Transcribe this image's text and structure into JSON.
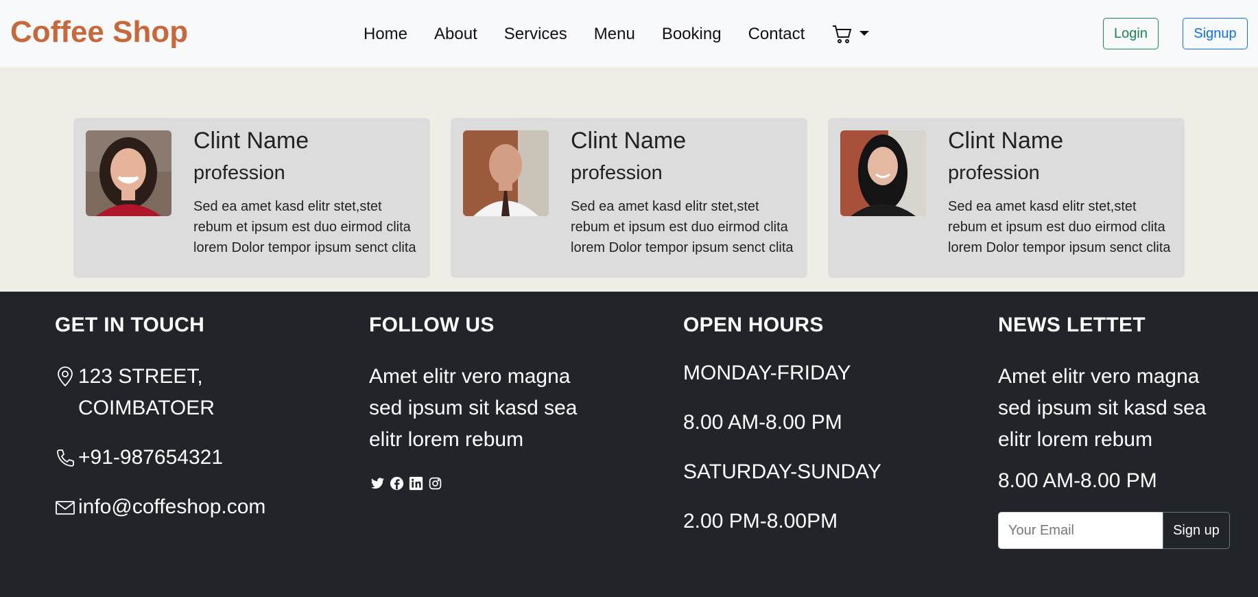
{
  "navbar": {
    "brand": "Coffee Shop",
    "links": [
      "Home",
      "About",
      "Services",
      "Menu",
      "Booking",
      "Contact"
    ],
    "cart_icon": "cart-icon",
    "login_label": "Login",
    "signup_label": "Signup"
  },
  "testimonials": [
    {
      "name": "Clint Name",
      "profession": "profession",
      "text": "Sed ea amet kasd elitr stet,stet rebum et ipsum est duo eirmod clita lorem Dolor tempor ipsum senct clita",
      "avatar": "woman-red-top"
    },
    {
      "name": "Clint Name",
      "profession": "profession",
      "text": "Sed ea amet kasd elitr stet,stet rebum et ipsum est duo eirmod clita lorem Dolor tempor ipsum senct clita",
      "avatar": "man-tie"
    },
    {
      "name": "Clint Name",
      "profession": "profession",
      "text": "Sed ea amet kasd elitr stet,stet rebum et ipsum est duo eirmod clita lorem Dolor tempor ipsum senct clita",
      "avatar": "woman-dark-hair"
    }
  ],
  "footer": {
    "contact": {
      "title": "GET IN TOUCH",
      "address": "123 STREET, COIMBATOER",
      "phone": "+91-987654321",
      "email": "info@coffeshop.com"
    },
    "follow": {
      "title": "FOLLOW US",
      "text": "Amet elitr vero magna sed ipsum sit kasd sea elitr lorem rebum",
      "icons": [
        "twitter-icon",
        "facebook-icon",
        "linkedin-icon",
        "instagram-icon"
      ]
    },
    "hours": {
      "title": "OPEN HOURS",
      "weekday_label": "MONDAY-FRIDAY",
      "weekday_time": "8.00 AM-8.00 PM",
      "weekend_label": "SATURDAY-SUNDAY",
      "weekend_time": "2.00 PM-8.00PM"
    },
    "newsletter": {
      "title": "NEWS LETTET",
      "text": "Amet elitr vero magna sed ipsum sit kasd sea elitr lorem rebum",
      "time": "8.00 AM-8.00 PM",
      "placeholder": "Your Email",
      "button": "Sign up"
    }
  },
  "colors": {
    "brand": "#c8683a",
    "footer_bg": "#212529",
    "section_bg": "#efeee6",
    "card_bg": "#dcdcdc"
  }
}
